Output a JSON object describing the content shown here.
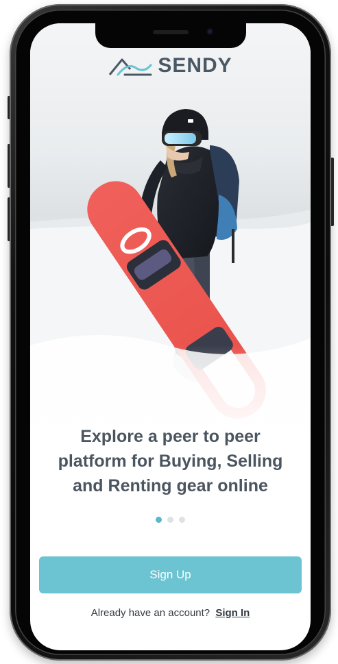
{
  "app": {
    "brand_name": "SENDY",
    "brand_color": "#6cc3d1",
    "logo_icon": "mountain-wave-logo-icon"
  },
  "onboarding": {
    "headline": "Explore a peer to peer platform for Buying, Selling and Renting gear online",
    "carousel": {
      "page_count": 3,
      "active_index": 0
    }
  },
  "actions": {
    "signup_label": "Sign Up",
    "account_prompt": "Already have an account?",
    "signin_label": "Sign In"
  },
  "colors": {
    "text": "#4b5560",
    "dot_active": "#5bb8cc",
    "dot_inactive": "#dfe2e5",
    "button": "#6cc3d1"
  }
}
